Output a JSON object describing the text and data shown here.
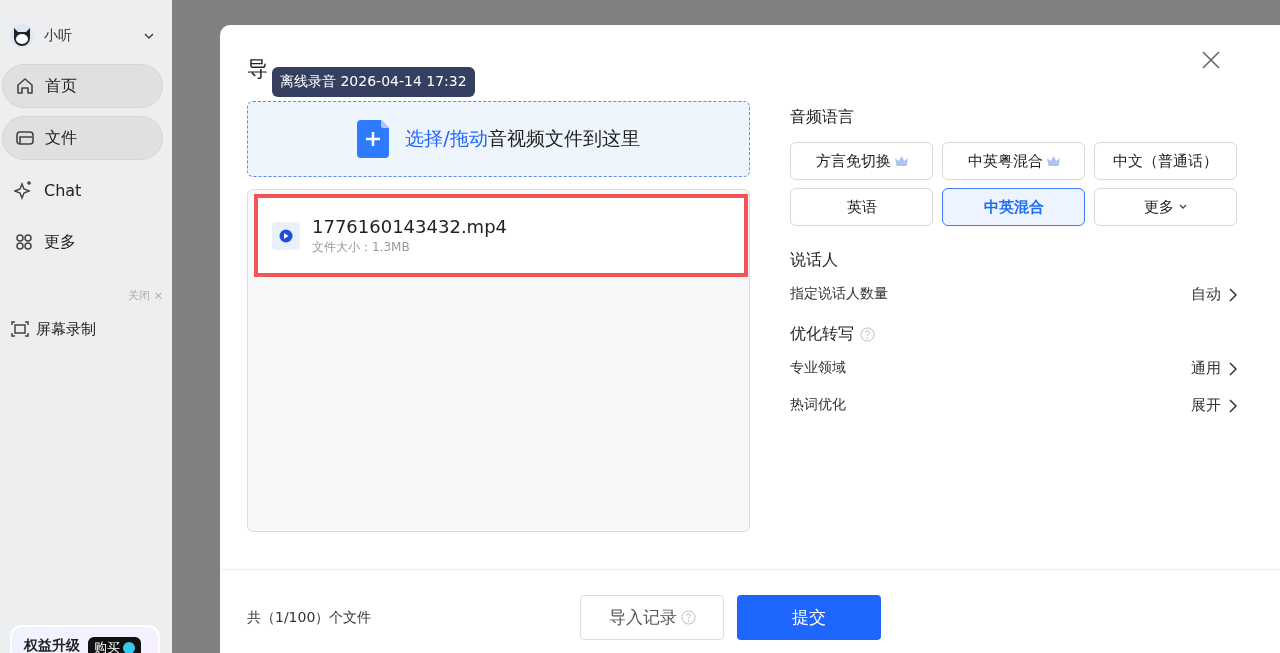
{
  "sidebar": {
    "user": {
      "name": "小听"
    },
    "items": [
      {
        "label": "首页",
        "selected": true
      },
      {
        "label": "文件",
        "selected": true
      },
      {
        "label": "Chat",
        "selected": false
      },
      {
        "label": "更多",
        "selected": false
      }
    ],
    "close_label": "关闭 ×",
    "tools": [
      {
        "label": "屏幕录制"
      }
    ],
    "upgrade": {
      "label": "权益升级",
      "button": "购买"
    }
  },
  "dialog": {
    "title": "导",
    "tooltip": "离线录音 2026-04-14 17:32",
    "dropzone": {
      "action": "选择/拖动",
      "text": "音视频文件到这里"
    },
    "files": [
      {
        "name": "1776160143432.mp4",
        "size": "文件大小：1.3MB",
        "highlighted": true
      }
    ],
    "language": {
      "title": "音频语言",
      "options": [
        {
          "label": "方言免切换",
          "premium": true,
          "selected": false,
          "kind": "plain"
        },
        {
          "label": "中英粤混合",
          "premium": true,
          "selected": false,
          "kind": "plain"
        },
        {
          "label": "中文（普通话）",
          "premium": false,
          "selected": false,
          "kind": "plain"
        },
        {
          "label": "英语",
          "premium": false,
          "selected": false,
          "kind": "plain"
        },
        {
          "label": "中英混合",
          "premium": false,
          "selected": true,
          "kind": "plain"
        },
        {
          "label": "更多",
          "premium": false,
          "selected": false,
          "kind": "dropdown"
        }
      ]
    },
    "sections": [
      {
        "title": "说话人",
        "help": false,
        "rows": [
          {
            "label": "指定说话人数量",
            "value": "自动"
          }
        ]
      },
      {
        "title": "优化转写",
        "help": true,
        "rows": [
          {
            "label": "专业领域",
            "value": "通用"
          },
          {
            "label": "热词优化",
            "value": "展开"
          }
        ]
      }
    ],
    "count": "共（1/100）个文件",
    "buttons": [
      {
        "label": "导入记录",
        "kind": "secondary"
      },
      {
        "label": "提交",
        "kind": "primary"
      }
    ]
  }
}
